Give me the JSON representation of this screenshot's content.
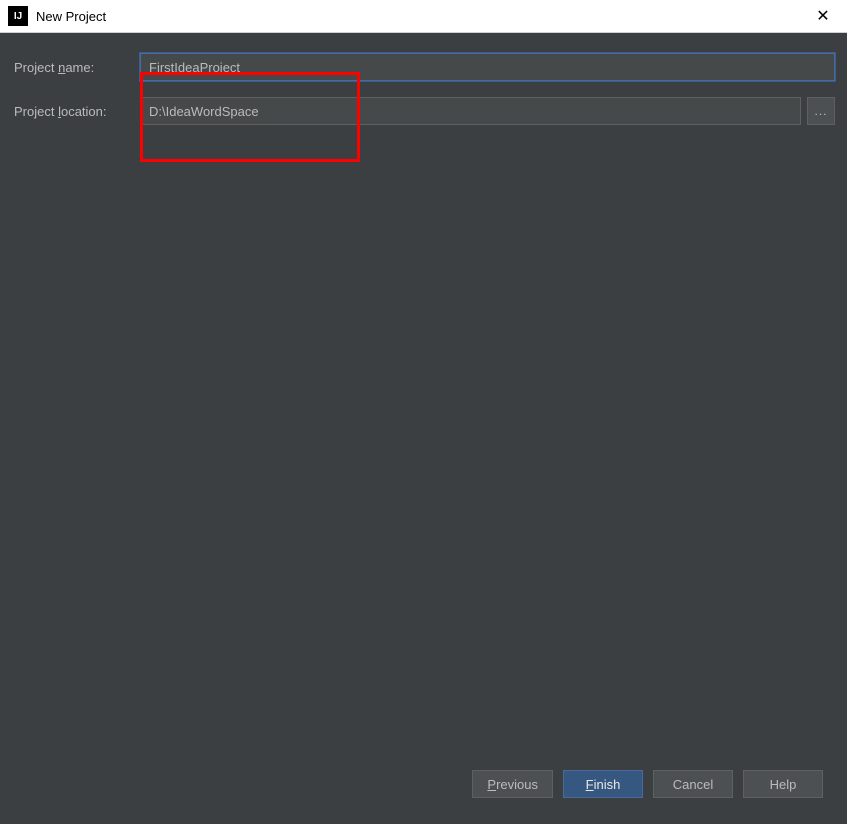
{
  "window": {
    "title": "New Project"
  },
  "form": {
    "project_name": {
      "label_pre": "Project ",
      "label_mnemonic": "n",
      "label_post": "ame:",
      "value": "FirstIdeaProject"
    },
    "project_location": {
      "label_pre": "Project ",
      "label_mnemonic": "l",
      "label_post": "ocation:",
      "value": "D:\\IdeaWordSpace",
      "browse_label": "..."
    }
  },
  "buttons": {
    "previous": {
      "mnemonic": "P",
      "post": "revious"
    },
    "finish": {
      "mnemonic": "F",
      "post": "inish"
    },
    "cancel": {
      "label": "Cancel"
    },
    "help": {
      "label": "Help"
    }
  }
}
